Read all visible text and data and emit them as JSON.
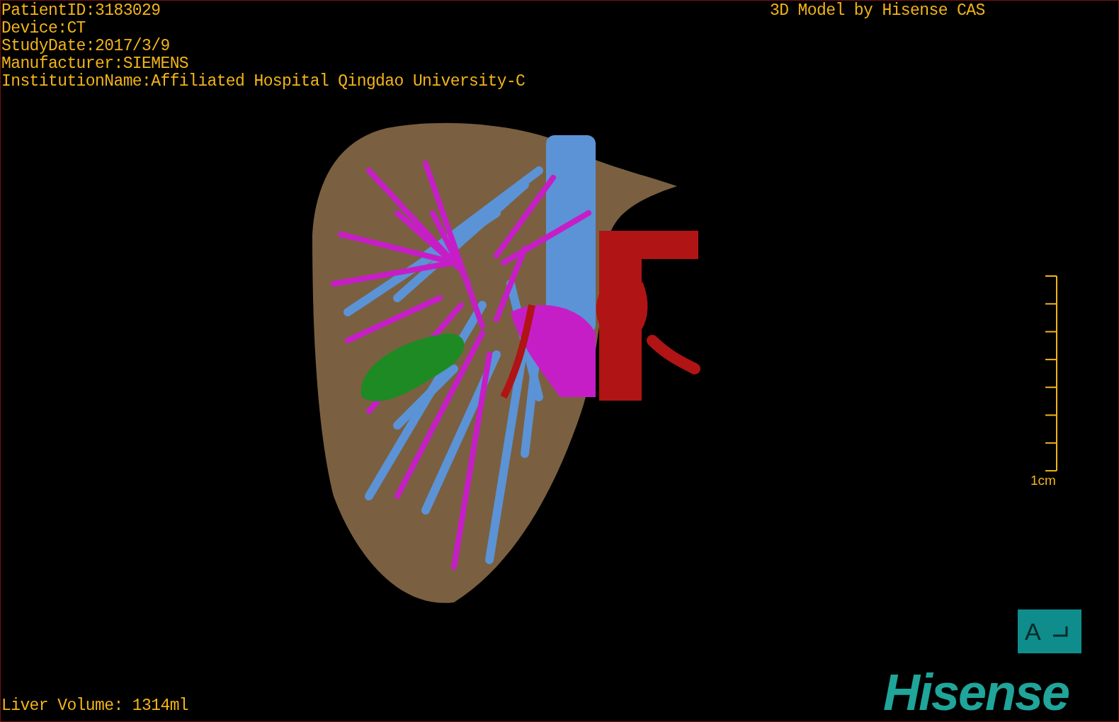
{
  "patient_info": [
    "PatientID:3183029",
    "Device:CT",
    "StudyDate:2017/3/9",
    "Manufacturer:SIEMENS",
    "InstitutionName:Affiliated Hospital Qingdao University-C"
  ],
  "title": "3D Model by Hisense CAS",
  "scale_label": "1cm",
  "orientation_cube": {
    "label": "A"
  },
  "liver_volume": "Liver Volume: 1314ml",
  "logo": "Hisense"
}
